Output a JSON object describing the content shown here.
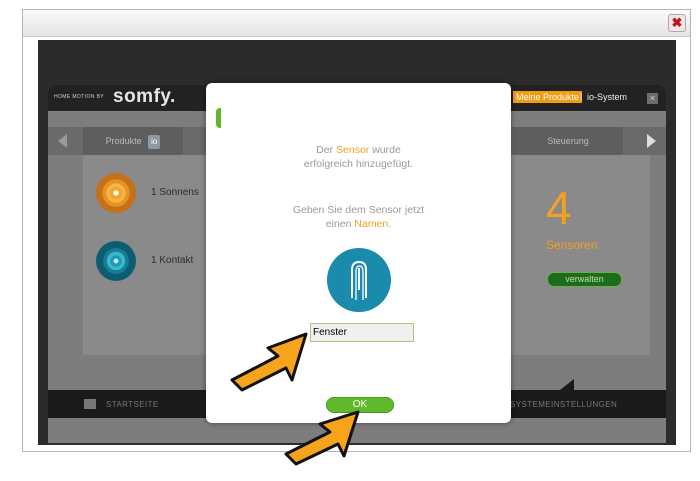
{
  "window": {
    "close_icon": "close-icon"
  },
  "app": {
    "brand_small": "HOME MOTION BY",
    "brand": "somfy.",
    "products_label": "Meine Produkte",
    "separator": "|",
    "io_system": "io-System",
    "header_close": "×"
  },
  "tabs": {
    "produkte": "Produkte",
    "io_badge": "io",
    "steuerung": "Steuerung"
  },
  "devices": [
    {
      "label": "1 Sonnens",
      "icon": "sun-sensor-icon"
    },
    {
      "label": "1 Kontakt",
      "icon": "contact-sensor-icon"
    }
  ],
  "summary": {
    "count": "4",
    "label": "Sensoren",
    "manage_button": "verwalten"
  },
  "footer": {
    "start": "STARTSEITE",
    "settings": "SYSTEMEINSTELLUNGEN"
  },
  "dialog": {
    "msg1_prefix": "Der ",
    "msg1_hl": "Sensor",
    "msg1_suffix": " wurde",
    "msg1_line2": "erfolgreich hinzugefügt.",
    "msg2_line1": "Geben Sie dem Sensor jetzt",
    "msg2_prefix": "einen ",
    "msg2_hl": "Namen",
    "msg2_suffix": ".",
    "name_value": "Fenster",
    "ok_label": "OK"
  },
  "colors": {
    "accent_orange": "#f5a020",
    "ok_green": "#5fb92a",
    "sensor_blue": "#1a8bac"
  }
}
